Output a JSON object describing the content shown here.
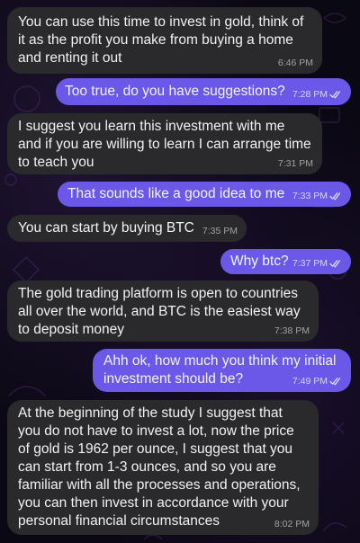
{
  "messages": [
    {
      "direction": "incoming",
      "text": "You can use this time to invest in gold, think of it as the profit you make from buying a home and renting it out",
      "time": "6:46 PM"
    },
    {
      "direction": "outgoing",
      "text": "Too true, do you have suggestions?",
      "time": "7:28 PM",
      "read": true
    },
    {
      "direction": "incoming",
      "text": "I suggest you learn this investment with me and if you are willing to learn I can arrange time to teach you",
      "time": "7:31 PM"
    },
    {
      "direction": "outgoing",
      "text": "That sounds like a good idea to me",
      "time": "7:33 PM",
      "read": true
    },
    {
      "direction": "incoming",
      "text": "You can start by buying BTC",
      "time": "7:35 PM"
    },
    {
      "direction": "outgoing",
      "text": "Why btc?",
      "time": "7:37 PM",
      "read": true
    },
    {
      "direction": "incoming",
      "text": "The gold trading platform is open to countries all over the world, and BTC is the easiest way to deposit money",
      "time": "7:38 PM"
    },
    {
      "direction": "outgoing",
      "text": "Ahh ok, how much you think my initial investment should be?",
      "time": "7:49 PM",
      "read": true
    },
    {
      "direction": "incoming",
      "text": "At the beginning of the study I suggest that you do not have to invest a lot, now the price of gold is 1962 per ounce, I suggest that you can start from 1-3 ounces, and so you are familiar with all the processes and operations, you can then invest in accordance with your personal financial circumstances",
      "time": "8:02 PM"
    }
  ],
  "colors": {
    "incoming_bubble": "#2a2a2d",
    "outgoing_bubble": "#6b58e8",
    "background": "#0a0812"
  },
  "icons": {
    "read_receipt": "double-check-icon",
    "wallpaper": "doodle-pattern"
  }
}
